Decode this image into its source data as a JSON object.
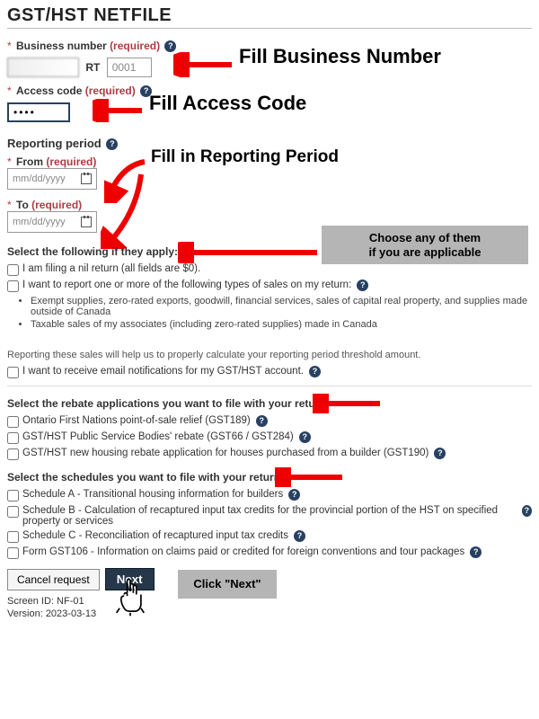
{
  "page": {
    "title": "GST/HST NETFILE"
  },
  "business_number": {
    "label": "Business number",
    "required": "(required)",
    "rt_label": "RT",
    "segment2_value": "0001"
  },
  "access_code": {
    "label": "Access code",
    "required": "(required)",
    "value": "••••"
  },
  "reporting_period": {
    "heading": "Reporting period",
    "from_label": "From",
    "to_label": "To",
    "required": "(required)",
    "placeholder": "mm/dd/yyyy"
  },
  "apply_section": {
    "heading": "Select the following if they apply:",
    "nil_return": "I am filing a nil return (all fields are $0).",
    "report_types": "I want to report one or more of the following types of sales on my return:",
    "bullet1": "Exempt supplies, zero-rated exports, goodwill, financial services, sales of capital real property, and supplies made outside of Canada",
    "bullet2": "Taxable sales of my associates (including zero-rated supplies) made in Canada",
    "helper_line": "Reporting these sales will help us to properly calculate your reporting period threshold amount.",
    "email_opt": "I want to receive email notifications for my GST/HST account."
  },
  "rebate_section": {
    "heading": "Select the rebate applications you want to file with your return:",
    "items": {
      "0": "Ontario First Nations point-of-sale relief (GST189)",
      "1": "GST/HST Public Service Bodies' rebate (GST66 / GST284)",
      "2": "GST/HST new housing rebate application for houses purchased from a builder (GST190)"
    }
  },
  "schedule_section": {
    "heading": "Select the schedules you want to file with your return:",
    "items": {
      "0": "Schedule A - Transitional housing information for builders",
      "1": "Schedule B - Calculation of recaptured input tax credits for the provincial portion of the HST on specified property or services",
      "2": "Schedule C - Reconciliation of recaptured input tax credits",
      "3": "Form GST106 - Information on claims paid or credited for foreign conventions and tour packages"
    }
  },
  "buttons": {
    "cancel": "Cancel request",
    "next": "Next"
  },
  "footer": {
    "screen_id_label": "Screen ID:",
    "screen_id_value": "NF-01",
    "version_label": "Version:",
    "version_value": "2023-03-13"
  },
  "annotations": {
    "bn": "Fill Business Number",
    "ac": "Fill Access Code",
    "rp": "Fill in Reporting Period",
    "choose_l1": "Choose any of them",
    "choose_l2": "if you are applicable",
    "next": "Click \"Next\""
  },
  "help_glyph": "?"
}
